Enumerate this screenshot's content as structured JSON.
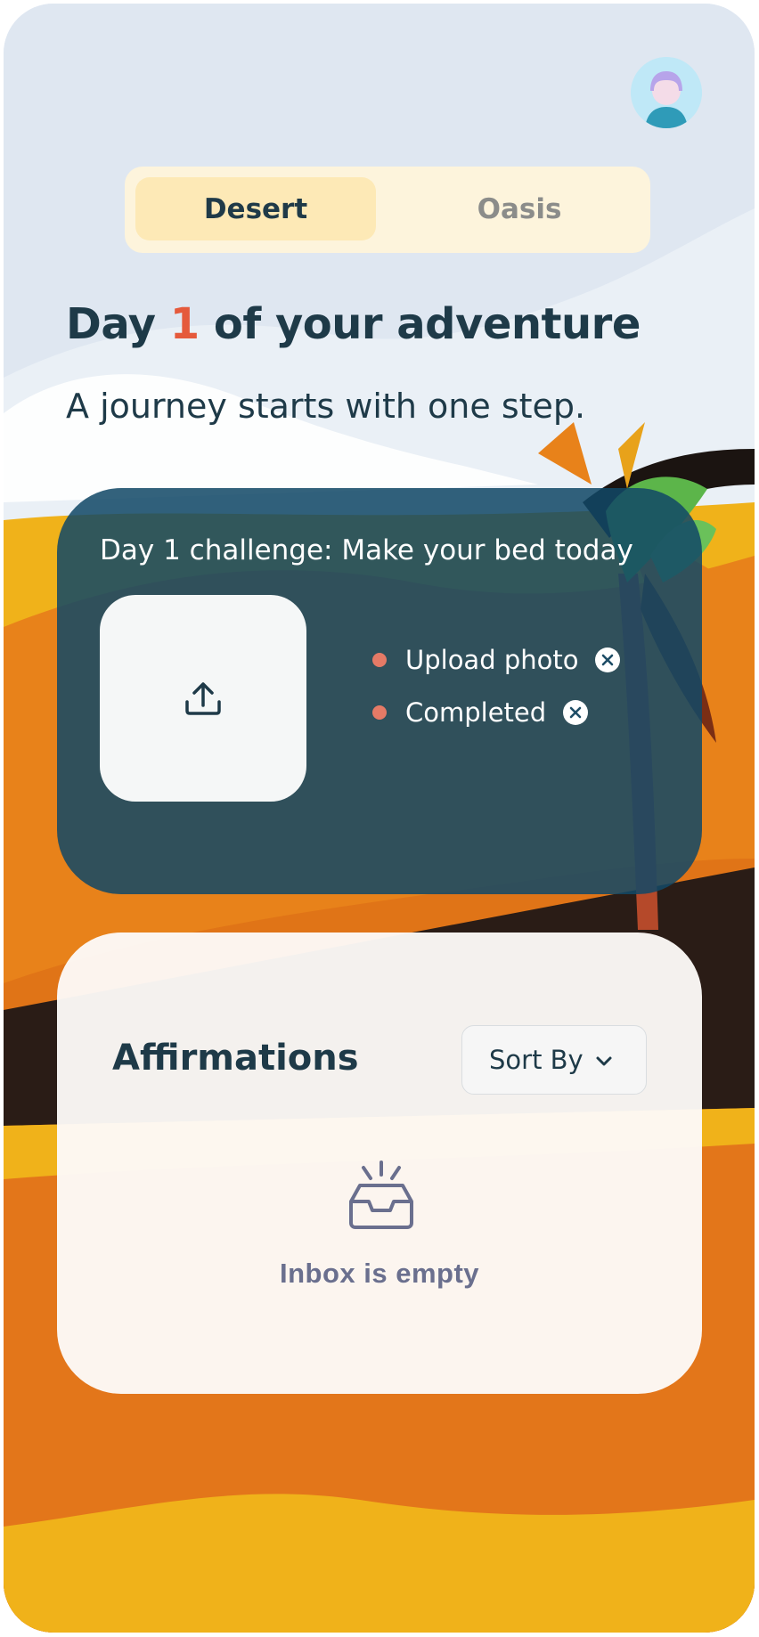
{
  "toggle": {
    "active": "Desert",
    "inactive": "Oasis"
  },
  "heading": {
    "prefix": "Day ",
    "day": "1",
    "suffix": " of your adventure"
  },
  "subheading": "A journey starts with one step.",
  "challenge": {
    "title": "Day 1 challenge: Make your bed today",
    "tasks": [
      {
        "label": "Upload photo"
      },
      {
        "label": "Completed"
      }
    ]
  },
  "affirmations": {
    "title": "Affirmations",
    "sort_label": "Sort By",
    "empty_text": "Inbox is empty"
  },
  "colors": {
    "accent": "#e55a3c",
    "heading": "#1e3a48",
    "card": "#124866",
    "sky": "#dfe7f1",
    "sand_orange": "#e8821a",
    "sand_yellow": "#f0b21a"
  },
  "icons": [
    "avatar",
    "upload-icon",
    "close-circle-icon",
    "chevron-down-icon",
    "inbox-icon",
    "palm-tree"
  ]
}
